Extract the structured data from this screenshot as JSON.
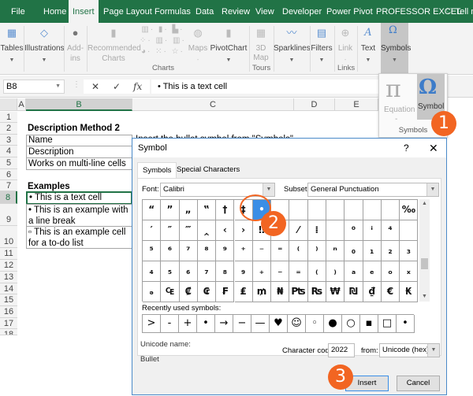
{
  "menubar": {
    "tabs": [
      "File",
      "Home",
      "Insert",
      "Page Layout",
      "Formulas",
      "Data",
      "Review",
      "View",
      "Developer",
      "Power Pivot",
      "PROFESSOR EXCEL"
    ],
    "active_tab": "Insert",
    "tell_me": "Tell m"
  },
  "ribbon": {
    "buttons": [
      {
        "label": "Tables",
        "icon": "table-icon"
      },
      {
        "label": "Illustrations",
        "icon": "shapes-icon"
      },
      {
        "label": "Add-",
        "label2": "ins",
        "icon": "addins-icon"
      },
      {
        "label": "Recommended",
        "label2": "Charts",
        "icon": "recommended-charts-icon"
      },
      {
        "label": "Maps",
        "icon": "globe-icon"
      },
      {
        "label": "PivotChart",
        "icon": "pivotchart-icon"
      },
      {
        "label": "3D",
        "label2": "Map",
        "icon": "3d-map-icon"
      },
      {
        "label": "Sparklines",
        "icon": "sparklines-icon"
      },
      {
        "label": "Filters",
        "icon": "filter-icon"
      },
      {
        "label": "Link",
        "icon": "link-icon"
      },
      {
        "label": "Text",
        "icon": "text-icon"
      },
      {
        "label": "Symbols",
        "icon": "omega-icon"
      }
    ],
    "groups": [
      "Charts",
      "Tours",
      "Links"
    ]
  },
  "formula_bar": {
    "name_box": "B8",
    "cancel": "✕",
    "enter": "✓",
    "fx": "fx",
    "content": "• This is a text cell"
  },
  "sheet": {
    "columns": [
      "A",
      "B",
      "C",
      "D",
      "E"
    ],
    "rows": [
      "1",
      "2",
      "3",
      "4",
      "5",
      "6",
      "7",
      "8",
      "9",
      "10",
      "11",
      "12",
      "13",
      "14",
      "15",
      "16",
      "17",
      "18"
    ],
    "cells": {
      "B2": "Description Method 2",
      "B3": "Name",
      "C3": "Insert the bullet symbol from \"Symbols\"",
      "B4": "Description",
      "B5": "Works on multi-line cells",
      "B7": "Examples",
      "B8": "• This is a text cell",
      "B9": "• This is an example with a line break",
      "B10": "▫ This is an example cell for a to-do list"
    },
    "selected_cell": "B8"
  },
  "symbols_dropdown": {
    "equation_label": "Equation",
    "equation_sub": "-",
    "symbol_label": "Symbol",
    "group_label": "Symbols",
    "pi": "π",
    "omega": "Ω"
  },
  "dialog": {
    "title": "Symbol",
    "help": "?",
    "close": "✕",
    "tabs": [
      "Symbols",
      "Special Characters"
    ],
    "font_label": "Font:",
    "font_value": "Calibri",
    "subset_label": "Subset:",
    "subset_value": "General Punctuation",
    "grid": [
      [
        "“",
        "”",
        "„",
        "‟",
        "†",
        "‡",
        "•",
        "",
        "",
        "",
        "",
        "",
        "",
        "",
        "‰"
      ],
      [
        "′",
        "″",
        "‴",
        "‸",
        "‹",
        "›",
        "‼",
        "‾",
        "⁄",
        "⁞",
        "",
        "⁰",
        "ⁱ",
        "⁴",
        ""
      ],
      [
        "⁵",
        "⁶",
        "⁷",
        "⁸",
        "⁹",
        "⁺",
        "⁻",
        "⁼",
        "⁽",
        "⁾",
        "ⁿ",
        "₀",
        "₁",
        "₂",
        "₃"
      ],
      [
        "₄",
        "₅",
        "₆",
        "₇",
        "₈",
        "₉",
        "₊",
        "₋",
        "₌",
        "₍",
        "₎",
        "ₐ",
        "ₑ",
        "ₒ",
        "ₓ"
      ],
      [
        "ₔ",
        "₠",
        "₡",
        "₢",
        "₣",
        "₤",
        "₥",
        "₦",
        "₧",
        "₨",
        "₩",
        "₪",
        "₫",
        "€",
        "₭"
      ]
    ],
    "selected_symbol": "•",
    "recent_label": "Recently used symbols:",
    "recent": [
      ">",
      "-",
      "+",
      "•",
      "→",
      "−",
      "—",
      "♥",
      "☺",
      "◦",
      "●",
      "○",
      "▪",
      "□",
      "•"
    ],
    "unicode_name_label": "Unicode name:",
    "unicode_name": "Bullet",
    "char_code_label": "Character code:",
    "char_code": "2022",
    "from_label": "from:",
    "from_value": "Unicode (hex)",
    "insert_label": "Insert",
    "cancel_label": "Cancel"
  },
  "callouts": [
    "1",
    "2",
    "3"
  ],
  "colors": {
    "excel_green": "#217346",
    "callout_orange": "#f26522",
    "selection_blue": "#3a8ee6"
  }
}
